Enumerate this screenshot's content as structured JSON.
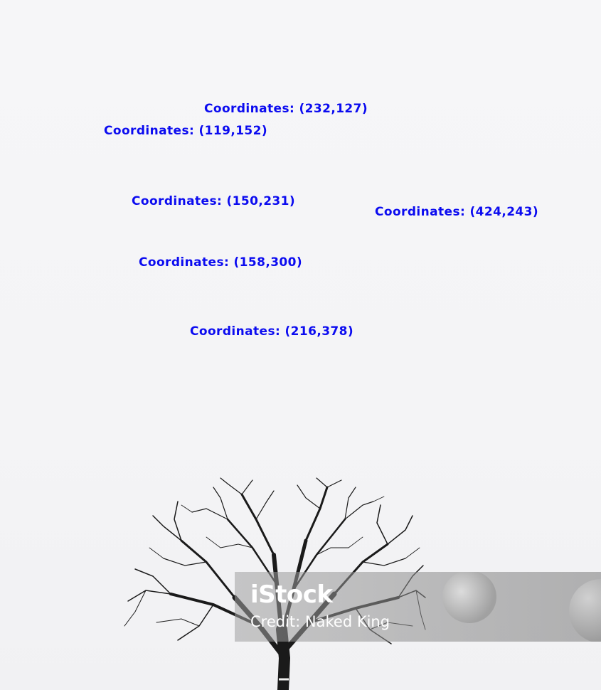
{
  "labels": [
    "Coordinates: (232,127)",
    "Coordinates: (119,152)",
    "Coordinates: (150,231)",
    "Coordinates: (424,243)",
    "Coordinates: (158,300)",
    "Coordinates: (216,378)"
  ],
  "watermark": {
    "brand": "iStock",
    "credit": "Credit: Naked King"
  },
  "colors": {
    "label_text": "#0b0bf0",
    "sky": "#f6f6f8",
    "tree": "#1a1a1a"
  }
}
